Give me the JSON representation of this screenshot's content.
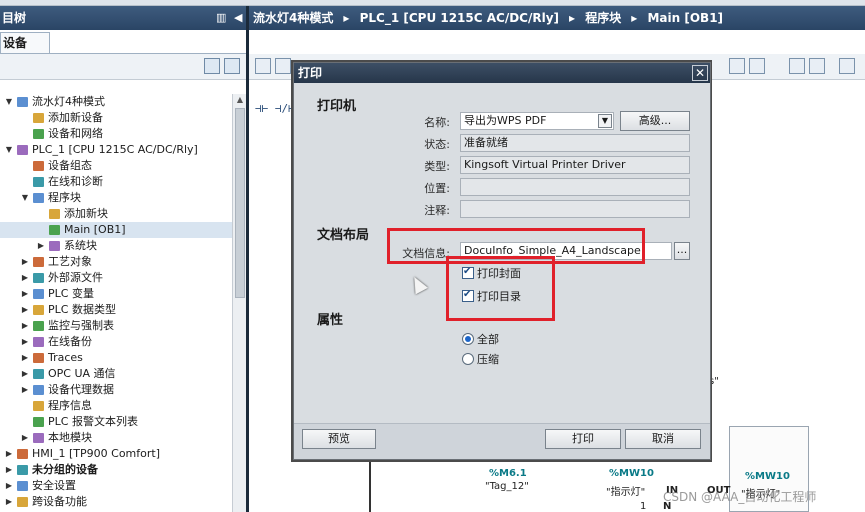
{
  "left_panel": {
    "title_partial": "目树",
    "tab_label": "设备",
    "tree": [
      {
        "label": "流水灯4种模式",
        "indent": 0,
        "expand": "▼",
        "bold": false
      },
      {
        "label": "添加新设备",
        "indent": 1,
        "expand": "",
        "bold": false
      },
      {
        "label": "设备和网络",
        "indent": 1,
        "expand": "",
        "bold": false
      },
      {
        "label": "PLC_1 [CPU 1215C AC/DC/Rly]",
        "indent": 0,
        "expand": "▼",
        "bold": false
      },
      {
        "label": "设备组态",
        "indent": 1,
        "expand": "",
        "bold": false
      },
      {
        "label": "在线和诊断",
        "indent": 1,
        "expand": "",
        "bold": false
      },
      {
        "label": "程序块",
        "indent": 1,
        "expand": "▼",
        "bold": false
      },
      {
        "label": "添加新块",
        "indent": 2,
        "expand": "",
        "bold": false
      },
      {
        "label": "Main [OB1]",
        "indent": 2,
        "expand": "",
        "bold": false,
        "selected": true
      },
      {
        "label": "系统块",
        "indent": 2,
        "expand": "▶",
        "bold": false
      },
      {
        "label": "工艺对象",
        "indent": 1,
        "expand": "▶",
        "bold": false
      },
      {
        "label": "外部源文件",
        "indent": 1,
        "expand": "▶",
        "bold": false
      },
      {
        "label": "PLC 变量",
        "indent": 1,
        "expand": "▶",
        "bold": false
      },
      {
        "label": "PLC 数据类型",
        "indent": 1,
        "expand": "▶",
        "bold": false
      },
      {
        "label": "监控与强制表",
        "indent": 1,
        "expand": "▶",
        "bold": false
      },
      {
        "label": "在线备份",
        "indent": 1,
        "expand": "▶",
        "bold": false
      },
      {
        "label": "Traces",
        "indent": 1,
        "expand": "▶",
        "bold": false
      },
      {
        "label": "OPC UA 通信",
        "indent": 1,
        "expand": "▶",
        "bold": false
      },
      {
        "label": "设备代理数据",
        "indent": 1,
        "expand": "▶",
        "bold": false
      },
      {
        "label": "程序信息",
        "indent": 1,
        "expand": "",
        "bold": false
      },
      {
        "label": "PLC 报警文本列表",
        "indent": 1,
        "expand": "",
        "bold": false
      },
      {
        "label": "本地模块",
        "indent": 1,
        "expand": "▶",
        "bold": false
      },
      {
        "label": "HMI_1 [TP900 Comfort]",
        "indent": 0,
        "expand": "▶",
        "bold": false
      },
      {
        "label": "未分组的设备",
        "indent": 0,
        "expand": "▶",
        "bold": true
      },
      {
        "label": "安全设置",
        "indent": 0,
        "expand": "▶",
        "bold": false
      },
      {
        "label": "跨设备功能",
        "indent": 0,
        "expand": "▶",
        "bold": false
      }
    ]
  },
  "breadcrumb": [
    "流水灯4种模式",
    "PLC_1 [CPU 1215C AC/DC/Rly]",
    "程序块",
    "Main [OB1]"
  ],
  "editor": {
    "ladder_symbol": "⊣⊢ ⊣/⊢",
    "addr1": "%M6.1",
    "tag1": "\"Tag_12\"",
    "addr2": "%MW10",
    "tag2": "\"指示灯\"",
    "addr3": "%MW10",
    "tag3": "\"指示灯\"",
    "pin_in": "IN",
    "pin_out": "OUT",
    "pin_n": "N",
    "pin_one": "1",
    "stray_s": "s\"",
    "watermark": "CSDN @AAA_自动化工程师"
  },
  "dialog": {
    "title": "打印",
    "close": "✕",
    "section_printer": "打印机",
    "label_name": "名称:",
    "name_value": "导出为WPS PDF",
    "advanced_button": "高级...",
    "label_status": "状态:",
    "status_value": "准备就绪",
    "label_type": "类型:",
    "type_value": "Kingsoft Virtual Printer Driver",
    "label_location": "位置:",
    "location_value": "",
    "label_comment": "注释:",
    "comment_value": "",
    "section_layout": "文档布局",
    "label_docinfo": "文档信息:",
    "docinfo_value": "DocuInfo_Simple_A4_Landscape",
    "browse_button": "...",
    "print_cover": "打印封面",
    "print_toc": "打印目录",
    "section_props": "属性",
    "radio_all": "全部",
    "radio_compact": "压缩",
    "preview_button": "预览",
    "print_button": "打印",
    "cancel_button": "取消"
  },
  "colors": {
    "highlight_box": "#e0202a",
    "title_bar": "#2a4565"
  }
}
